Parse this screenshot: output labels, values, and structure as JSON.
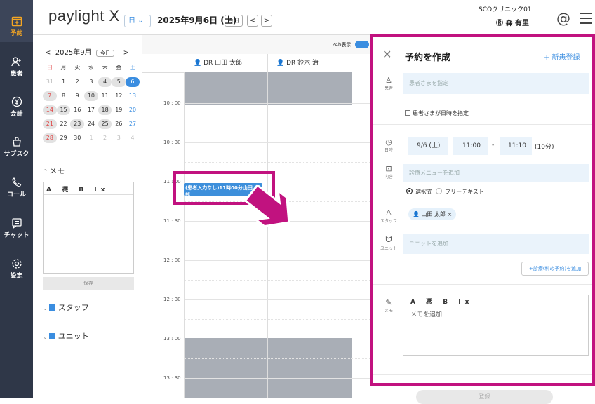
{
  "nav": {
    "items": [
      {
        "label": "予約",
        "icon": "calendar-plus-icon"
      },
      {
        "label": "患者",
        "icon": "person-add-icon"
      },
      {
        "label": "会計",
        "icon": "yen-icon"
      },
      {
        "label": "サブスク",
        "icon": "subscription-icon"
      },
      {
        "label": "コール",
        "icon": "phone-icon"
      },
      {
        "label": "チャット",
        "icon": "chat-icon"
      },
      {
        "label": "設定",
        "icon": "gear-icon"
      }
    ]
  },
  "header": {
    "logo": "paylight X",
    "view": "日",
    "date": "2025年9月6日 (土)",
    "today": "今日",
    "prev": "<",
    "next": ">",
    "clinic": "SCOクリニック01",
    "user": "森 有里",
    "at": "@"
  },
  "mini_cal": {
    "month": "2025年9月",
    "today": "今日",
    "prev": "<",
    "next": ">",
    "weekdays": [
      "日",
      "月",
      "火",
      "水",
      "木",
      "金",
      "土"
    ],
    "weeks": [
      [
        "31",
        "1",
        "2",
        "3",
        "4",
        "5",
        "6"
      ],
      [
        "7",
        "8",
        "9",
        "10",
        "11",
        "12",
        "13"
      ],
      [
        "14",
        "15",
        "16",
        "17",
        "18",
        "19",
        "20"
      ],
      [
        "21",
        "22",
        "23",
        "24",
        "25",
        "26",
        "27"
      ],
      [
        "28",
        "29",
        "30",
        "1",
        "2",
        "3",
        "4"
      ]
    ]
  },
  "memo": {
    "title": "メモ",
    "tools": "A 凞 B Ix",
    "save": "保存"
  },
  "filters": {
    "staff": "スタッフ",
    "unit": "ユニット"
  },
  "calendar": {
    "toggle_label": "24h表示",
    "staff": [
      "DR 山田 太郎",
      "DR 鈴木 治"
    ],
    "times": [
      "10 : 00",
      "10 : 30",
      "11 : 00",
      "11 : 30",
      "12 : 00",
      "12 : 30",
      "13 : 00",
      "13 : 30"
    ],
    "appointment": "(患者入力なし)11時00分山田 太郎"
  },
  "form": {
    "title": "予約を作成",
    "new_patient": "+ 新患登録",
    "patient_label": "患者",
    "patient_placeholder": "患者さまを指定",
    "patient_check": "患者さまが日時を指定",
    "datetime_label": "日時",
    "date": "9/6 (土)",
    "start": "11:00",
    "dash": "-",
    "end": "11:10",
    "duration": "(10分)",
    "menu_label": "内容",
    "menu_placeholder": "診療メニューを追加",
    "radio_select": "選択式",
    "radio_free": "フリーテキスト",
    "staff_label": "スタッフ",
    "staff_chip": "山田 太郎 ×",
    "unit_label": "ユニット",
    "unit_placeholder": "ユニットを追加",
    "add_diag": "+診療(料め予約)を追加",
    "memo_label": "メモ",
    "memo_tools": "A 凞 B Ix",
    "memo_placeholder": "メモを追加",
    "submit": "登録"
  }
}
